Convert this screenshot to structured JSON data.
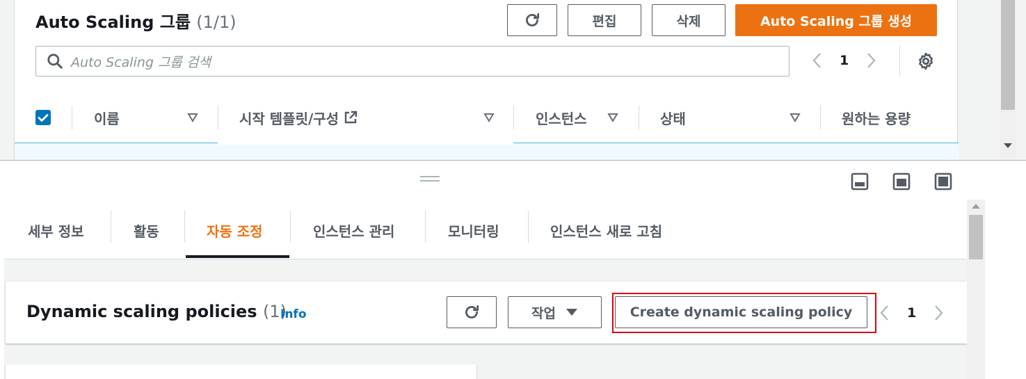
{
  "asg": {
    "title": "Auto Scaling 그룹",
    "count": "(1/1)",
    "refresh_icon": "refresh-icon",
    "edit_label": "편집",
    "delete_label": "삭제",
    "create_label": "Auto Scaling 그룹 생성",
    "search_placeholder": "Auto Scaling 그룹 검색",
    "page": "1",
    "columns": [
      {
        "label": "이름"
      },
      {
        "label": "시작 템플릿/구성"
      },
      {
        "label": "인스턴스"
      },
      {
        "label": "상태"
      },
      {
        "label": "원하는 용량"
      }
    ]
  },
  "tabs": [
    {
      "label": "세부 정보"
    },
    {
      "label": "활동"
    },
    {
      "label": "자동 조정"
    },
    {
      "label": "인스턴스 관리"
    },
    {
      "label": "모니터링"
    },
    {
      "label": "인스턴스 새로 고침"
    }
  ],
  "active_tab": "자동 조정",
  "policies": {
    "title": "Dynamic scaling policies",
    "count": "(1)",
    "info_label": "Info",
    "actions_label": "작업",
    "create_label": "Create dynamic scaling policy",
    "page": "1"
  },
  "colors": {
    "primary": "#ec7211",
    "link": "#0073bb",
    "highlight": "#e0000e"
  }
}
